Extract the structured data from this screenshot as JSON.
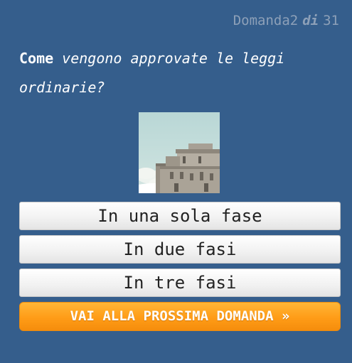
{
  "header": {
    "counter_prefix": "Domanda2",
    "counter_of": "di",
    "counter_total": "31"
  },
  "question": {
    "bold_part": "Come",
    "italic_part": "vengono approvate le leggi ordinarie?"
  },
  "image": {
    "icon": "building-photo"
  },
  "answers": [
    {
      "label": "In una sola fase"
    },
    {
      "label": "In due fasi"
    },
    {
      "label": "In tre fasi"
    }
  ],
  "next_button": {
    "label": "VAI ALLA PROSSIMA DOMANDA »"
  },
  "colors": {
    "background": "#355e8c",
    "counter": "#8da0b8",
    "next_button": "#ff9c17"
  }
}
